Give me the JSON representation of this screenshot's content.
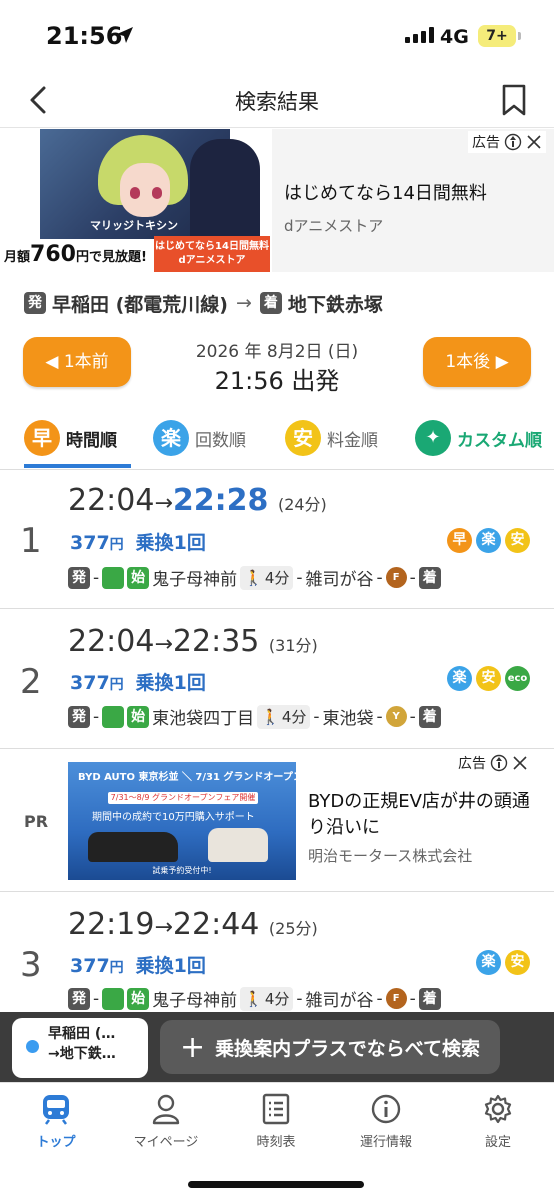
{
  "status": {
    "time": "21:56",
    "network": "4G",
    "battery": "7+"
  },
  "nav": {
    "title": "検索結果"
  },
  "top_ad": {
    "label": "広告",
    "headline": "はじめてなら14日間無料",
    "advertiser": "dアニメストア",
    "image_title": "マリッジトキシン",
    "price_prefix": "月額",
    "price": "760",
    "price_suffix": "円で見放題!",
    "banner_line1": "はじめてなら14日間無料",
    "banner_line2": "dアニメストア"
  },
  "route": {
    "from_tag": "発",
    "from": "早稲田 (都電荒川線)",
    "arrow": "→",
    "to_tag": "着",
    "to": "地下鉄赤塚"
  },
  "time_select": {
    "prev": "1本前",
    "next": "1本後",
    "date": "2026 年 8月2日 (日)",
    "departure": "21:56 出発"
  },
  "sort_tabs": [
    {
      "icon": "早",
      "label": "時間順",
      "color": "#f39418"
    },
    {
      "icon": "楽",
      "label": "回数順",
      "color": "#3ba3e8"
    },
    {
      "icon": "安",
      "label": "料金順",
      "color": "#f2c318"
    },
    {
      "icon": "✦",
      "label": "カスタム順",
      "color": "#1aa874"
    }
  ],
  "results": [
    {
      "index": "1",
      "dep": "22:04",
      "arr": "22:28",
      "duration": "(24分)",
      "fare": "377",
      "fare_unit": "円",
      "transfers": "乗換1回",
      "badges": [
        "早",
        "楽",
        "安"
      ],
      "step_from": "発",
      "step_start": "始",
      "station": "鬼子母神前",
      "walk": "4分",
      "station2": "雑司が谷",
      "line": "F",
      "step_to": "着"
    },
    {
      "index": "2",
      "dep": "22:04",
      "arr": "22:35",
      "duration": "(31分)",
      "fare": "377",
      "fare_unit": "円",
      "transfers": "乗換1回",
      "badges": [
        "楽",
        "安",
        "eco"
      ],
      "step_from": "発",
      "step_start": "始",
      "station": "東池袋四丁目",
      "walk": "4分",
      "station2": "東池袋",
      "line": "Y",
      "step_to": "着"
    },
    {
      "index": "3",
      "dep": "22:19",
      "arr": "22:44",
      "duration": "(25分)",
      "fare": "377",
      "fare_unit": "円",
      "transfers": "乗換1回",
      "badges": [
        "楽",
        "安"
      ],
      "step_from": "発",
      "step_start": "始",
      "station": "鬼子母神前",
      "walk": "4分",
      "station2": "雑司が谷",
      "line": "F",
      "step_to": "着"
    }
  ],
  "pr_ad": {
    "pr": "PR",
    "label": "広告",
    "headline": "BYDの正規EV店が井の頭通り沿いに",
    "advertiser": "明治モータース株式会社",
    "img_line1": "BYD AUTO 東京杉並 ＼ 7/31 グランドオープン／",
    "img_line2": "7/31〜8/9 グランドオープンフェア開催",
    "img_line3": "期間中の成約で10万円購入サポート",
    "img_line4": "試乗予約受付中!"
  },
  "float": {
    "history_line1": "早稲田 (…",
    "history_line2": "→地下鉄…",
    "compare_button": "乗換案内プラスでならべて検索"
  },
  "tabbar": [
    {
      "label": "トップ",
      "icon": "train-icon"
    },
    {
      "label": "マイページ",
      "icon": "person-icon"
    },
    {
      "label": "時刻表",
      "icon": "list-icon"
    },
    {
      "label": "運行情報",
      "icon": "info-icon"
    },
    {
      "label": "設定",
      "icon": "gear-icon"
    }
  ]
}
